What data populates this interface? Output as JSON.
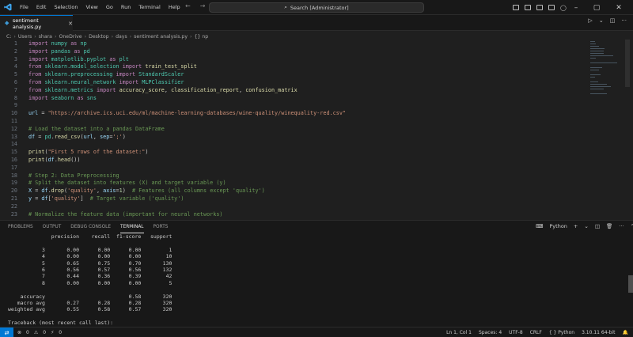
{
  "menu": [
    "File",
    "Edit",
    "Selection",
    "View",
    "Go",
    "Run",
    "Terminal",
    "Help"
  ],
  "search": {
    "text": "Search [Administrator]"
  },
  "tab": {
    "label": "sentiment analysis.py"
  },
  "breadcrumb": {
    "parts": [
      "C:",
      "Users",
      "shara",
      "OneDrive",
      "Desktop",
      "days",
      "sentiment analysis.py",
      "{} np"
    ]
  },
  "editor": {
    "lines": [
      {
        "n": "1",
        "tokens": [
          [
            "kw",
            "import "
          ],
          [
            "mod",
            "numpy "
          ],
          [
            "kw",
            "as "
          ],
          [
            "mod",
            "np"
          ]
        ]
      },
      {
        "n": "2",
        "tokens": [
          [
            "kw",
            "import "
          ],
          [
            "mod",
            "pandas "
          ],
          [
            "kw",
            "as "
          ],
          [
            "mod",
            "pd"
          ]
        ]
      },
      {
        "n": "3",
        "tokens": [
          [
            "kw",
            "import "
          ],
          [
            "mod",
            "matplotlib.pyplot "
          ],
          [
            "kw",
            "as "
          ],
          [
            "mod",
            "plt"
          ]
        ]
      },
      {
        "n": "4",
        "tokens": [
          [
            "kw",
            "from "
          ],
          [
            "mod",
            "sklearn.model_selection "
          ],
          [
            "kw",
            "import "
          ],
          [
            "fn",
            "train_test_split"
          ]
        ]
      },
      {
        "n": "5",
        "tokens": [
          [
            "kw",
            "from "
          ],
          [
            "mod",
            "sklearn.preprocessing "
          ],
          [
            "kw",
            "import "
          ],
          [
            "mod",
            "StandardScaler"
          ]
        ]
      },
      {
        "n": "6",
        "tokens": [
          [
            "kw",
            "from "
          ],
          [
            "mod",
            "sklearn.neural_network "
          ],
          [
            "kw",
            "import "
          ],
          [
            "mod",
            "MLPClassifier"
          ]
        ]
      },
      {
        "n": "7",
        "tokens": [
          [
            "kw",
            "from "
          ],
          [
            "mod",
            "sklearn.metrics "
          ],
          [
            "kw",
            "import "
          ],
          [
            "fn",
            "accuracy_score"
          ],
          [
            "plain",
            ", "
          ],
          [
            "fn",
            "classification_report"
          ],
          [
            "plain",
            ", "
          ],
          [
            "fn",
            "confusion_matrix"
          ]
        ]
      },
      {
        "n": "8",
        "tokens": [
          [
            "kw",
            "import "
          ],
          [
            "mod",
            "seaborn "
          ],
          [
            "kw",
            "as "
          ],
          [
            "mod",
            "sns"
          ]
        ]
      },
      {
        "n": "9",
        "tokens": []
      },
      {
        "n": "10",
        "tokens": [
          [
            "var",
            "url "
          ],
          [
            "plain",
            "= "
          ],
          [
            "str",
            "\"https://archive.ics.uci.edu/ml/machine-learning-databases/wine-quality/winequality-red.csv\""
          ]
        ]
      },
      {
        "n": "11",
        "tokens": []
      },
      {
        "n": "12",
        "tokens": [
          [
            "com",
            "# Load the dataset into a pandas DataFrame"
          ]
        ]
      },
      {
        "n": "13",
        "tokens": [
          [
            "var",
            "df "
          ],
          [
            "plain",
            "= "
          ],
          [
            "mod",
            "pd"
          ],
          [
            "plain",
            "."
          ],
          [
            "fn",
            "read_csv"
          ],
          [
            "plain",
            "("
          ],
          [
            "var",
            "url"
          ],
          [
            "plain",
            ", "
          ],
          [
            "var",
            "sep"
          ],
          [
            "plain",
            "="
          ],
          [
            "str",
            "';'"
          ],
          [
            "plain",
            ")"
          ]
        ]
      },
      {
        "n": "14",
        "tokens": []
      },
      {
        "n": "15",
        "tokens": [
          [
            "fn",
            "print"
          ],
          [
            "plain",
            "("
          ],
          [
            "str",
            "\"First 5 rows of the dataset:\""
          ],
          [
            "plain",
            ")"
          ]
        ]
      },
      {
        "n": "16",
        "tokens": [
          [
            "fn",
            "print"
          ],
          [
            "plain",
            "("
          ],
          [
            "var",
            "df"
          ],
          [
            "plain",
            "."
          ],
          [
            "fn",
            "head"
          ],
          [
            "plain",
            "())"
          ]
        ]
      },
      {
        "n": "17",
        "tokens": []
      },
      {
        "n": "18",
        "tokens": [
          [
            "com",
            "# Step 2: Data Preprocessing"
          ]
        ]
      },
      {
        "n": "19",
        "tokens": [
          [
            "com",
            "# Split the dataset into features (X) and target variable (y)"
          ]
        ]
      },
      {
        "n": "20",
        "tokens": [
          [
            "var",
            "X "
          ],
          [
            "plain",
            "= "
          ],
          [
            "var",
            "df"
          ],
          [
            "plain",
            "."
          ],
          [
            "fn",
            "drop"
          ],
          [
            "plain",
            "("
          ],
          [
            "str",
            "'quality'"
          ],
          [
            "plain",
            ", "
          ],
          [
            "var",
            "axis"
          ],
          [
            "plain",
            "="
          ],
          [
            "num",
            "1"
          ],
          [
            "plain",
            ")  "
          ],
          [
            "com",
            "# Features (all columns except 'quality')"
          ]
        ]
      },
      {
        "n": "21",
        "tokens": [
          [
            "var",
            "y "
          ],
          [
            "plain",
            "= "
          ],
          [
            "var",
            "df"
          ],
          [
            "plain",
            "["
          ],
          [
            "str",
            "'quality'"
          ],
          [
            "plain",
            "]  "
          ],
          [
            "com",
            "# Target variable ('quality')"
          ]
        ]
      },
      {
        "n": "22",
        "tokens": []
      },
      {
        "n": "23",
        "tokens": [
          [
            "com",
            "# Normalize the feature data (important for neural networks)"
          ]
        ]
      }
    ]
  },
  "panel": {
    "tabs": [
      "PROBLEMS",
      "OUTPUT",
      "DEBUG CONSOLE",
      "TERMINAL",
      "PORTS"
    ],
    "active_tab": "TERMINAL",
    "shell_label": "Python",
    "terminal_lines": [
      "              precision    recall  f1-score   support",
      "",
      "           3       0.00      0.00      0.00         1",
      "           4       0.00      0.00      0.00        10",
      "           5       0.65      0.75      0.70       130",
      "           6       0.56      0.57      0.56       132",
      "           7       0.44      0.36      0.39        42",
      "           8       0.00      0.00      0.00         5",
      "",
      "    accuracy                           0.58       320",
      "   macro avg       0.27      0.28      0.28       320",
      "weighted avg       0.55      0.58      0.57       320",
      "",
      "Traceback (most recent call last):"
    ]
  },
  "status": {
    "errors": "0",
    "warnings": "0",
    "ports": "0",
    "position": "Ln 1, Col 1",
    "spaces": "Spaces: 4",
    "encoding": "UTF-8",
    "eol": "CRLF",
    "language": "Python",
    "interpreter": "3.10.11 64-bit"
  },
  "colors": {
    "accent": "#0078d4",
    "background": "#1f1f1f",
    "chrome": "#181818"
  }
}
